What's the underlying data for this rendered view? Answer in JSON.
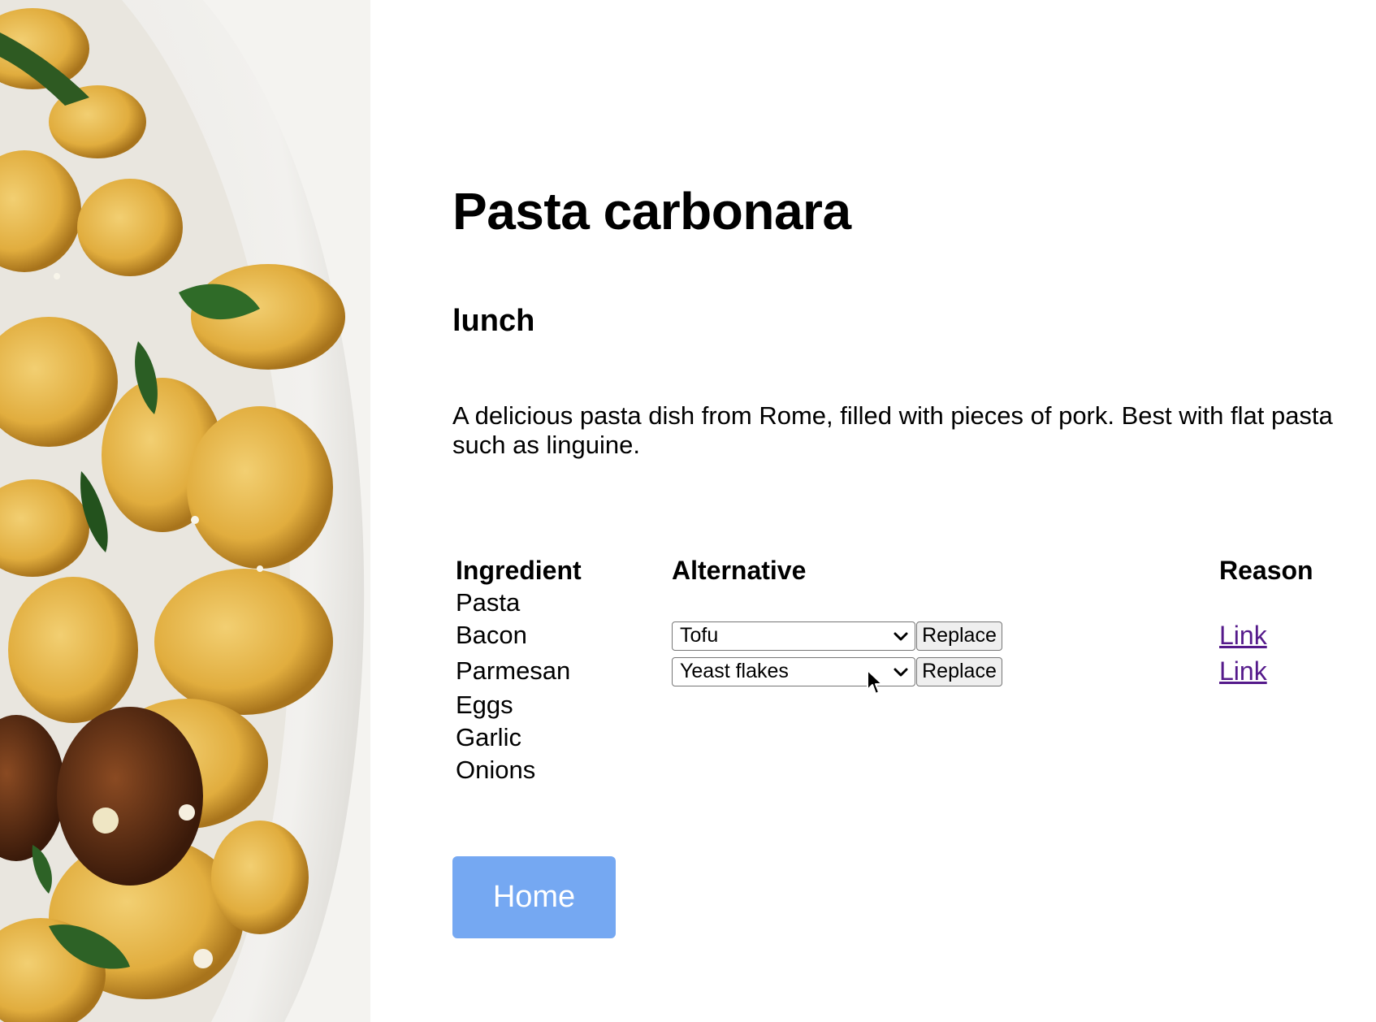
{
  "recipe": {
    "title": "Pasta carbonara",
    "meal_type": "lunch",
    "description": "A delicious pasta dish from Rome, filled with pieces of pork. Best with flat pasta such as linguine."
  },
  "table": {
    "headers": {
      "ingredient": "Ingredient",
      "alternative": "Alternative",
      "reason": "Reason"
    },
    "rows": [
      {
        "ingredient": "Pasta"
      },
      {
        "ingredient": "Bacon",
        "alternative": "Tofu",
        "replace_label": "Replace",
        "reason_link": "Link"
      },
      {
        "ingredient": "Parmesan",
        "alternative": "Yeast flakes",
        "replace_label": "Replace",
        "reason_link": "Link"
      },
      {
        "ingredient": "Eggs"
      },
      {
        "ingredient": "Garlic"
      },
      {
        "ingredient": "Onions"
      }
    ]
  },
  "home_button": "Home",
  "colors": {
    "home_button_bg": "#75a8f2",
    "link": "#551a8b"
  }
}
